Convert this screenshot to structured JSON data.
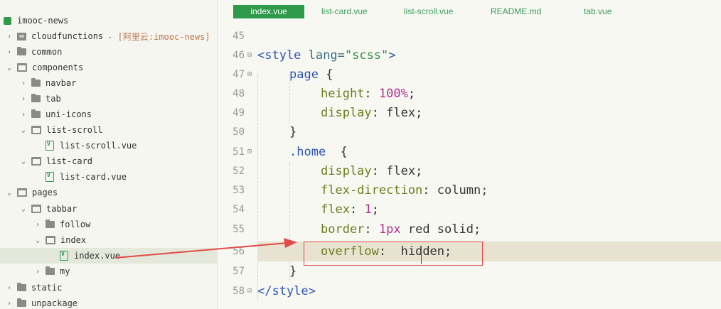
{
  "sidebar": {
    "project": "imooc-news",
    "items": [
      {
        "label": "cloudfunctions",
        "note": "- [阿里云:imooc-news]"
      },
      {
        "label": "common"
      },
      {
        "label": "components"
      },
      {
        "label": "navbar"
      },
      {
        "label": "tab"
      },
      {
        "label": "uni-icons"
      },
      {
        "label": "list-scroll"
      },
      {
        "label": "list-scroll.vue"
      },
      {
        "label": "list-card"
      },
      {
        "label": "list-card.vue"
      },
      {
        "label": "pages"
      },
      {
        "label": "tabbar"
      },
      {
        "label": "follow"
      },
      {
        "label": "index"
      },
      {
        "label": "index.vue"
      },
      {
        "label": "my"
      },
      {
        "label": "static"
      },
      {
        "label": "unpackage"
      }
    ]
  },
  "tabs": [
    {
      "label": "index.vue",
      "active": true
    },
    {
      "label": "list-card.vue"
    },
    {
      "label": "list-scroll.vue"
    },
    {
      "label": "README.md"
    },
    {
      "label": "tab.vue"
    }
  ],
  "editor": {
    "line_numbers": [
      "45",
      "46",
      "47",
      "48",
      "49",
      "50",
      "51",
      "52",
      "53",
      "54",
      "55",
      "56",
      "57",
      "58"
    ],
    "tokens": {
      "style_open_tag": "<style",
      "style_attr": "lang=",
      "style_attr_val": "\"scss\"",
      "style_close_bracket": ">",
      "page_sel": "page",
      "brace_open": "{",
      "brace_close": "}",
      "height_prop": "height",
      "height_val": "100%",
      "display_prop": "display",
      "flex_val": "flex",
      "home_sel": ".home",
      "flex_dir_prop": "flex-direction",
      "column_val": "column",
      "flex_prop": "flex",
      "one_val": "1",
      "border_prop": "border",
      "border_num": "1px",
      "border_rest": " red solid",
      "overflow_prop": "overflow",
      "hidden_val": " hidden",
      "colon": ": ",
      "semicolon": ";",
      "style_end_tag": "</style>"
    }
  },
  "colors": {
    "accent_green": "#2f9a4b",
    "annotation_red": "#e24b4b"
  }
}
